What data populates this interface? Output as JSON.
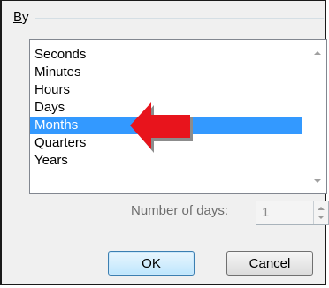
{
  "group": {
    "title_accel": "B",
    "title_rest": "y"
  },
  "list": {
    "items": [
      "Seconds",
      "Minutes",
      "Hours",
      "Days",
      "Months",
      "Quarters",
      "Years"
    ],
    "selected_index": 4
  },
  "number_of_days": {
    "label": "Number of days:",
    "value": "1"
  },
  "buttons": {
    "ok": "OK",
    "cancel": "Cancel"
  },
  "colors": {
    "selection": "#3399ff",
    "arrow": "#e8141c"
  },
  "icons": {
    "annotation": "red-arrow-icon",
    "scroll_up": "scroll-up-arrow-icon",
    "scroll_down": "scroll-down-arrow-icon"
  }
}
